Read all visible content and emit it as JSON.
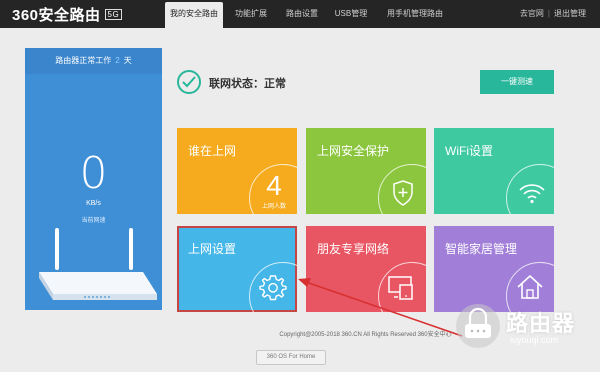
{
  "header": {
    "logo_text": "360安全路由",
    "logo_version": "5G",
    "tabs": [
      {
        "label": "我的安全路由"
      },
      {
        "label": "功能扩展"
      },
      {
        "label": "路由设置"
      },
      {
        "label": "USB管理"
      },
      {
        "label": "用手机管理路由"
      }
    ],
    "user_links": {
      "login": "去官网",
      "logout": "退出管理"
    }
  },
  "left_panel": {
    "uptime_prefix": "路由器正常工作",
    "uptime_days": "2",
    "uptime_suffix": "天",
    "speed_value": "0",
    "speed_unit": "KB/s",
    "speed_label": "当前网速"
  },
  "status": {
    "label": "联网状态：正常",
    "test_button": "一键测速"
  },
  "tiles": [
    {
      "title": "谁在上网",
      "count": "4",
      "count_label": "上网人数",
      "color": "#f6ab1f"
    },
    {
      "title": "上网安全保护",
      "color": "#8cc63f"
    },
    {
      "title": "WiFi设置",
      "color": "#3ec9a0"
    },
    {
      "title": "上网设置",
      "color": "#45b6e8"
    },
    {
      "title": "朋友专享网络",
      "color": "#e85563"
    },
    {
      "title": "智能家居管理",
      "color": "#a17fd8"
    }
  ],
  "footer": {
    "copyright": "Copyright@2005-2018 360.CN All Rights Reserved 360安全中心",
    "os_button": "360 OS For Home"
  },
  "watermark": {
    "title": "路由器",
    "subtitle": "luyouqi.com"
  },
  "colors": {
    "accent": "#28b79b",
    "topbar": "#252525",
    "panel": "#3f8fd6",
    "highlight": "#c64545"
  }
}
